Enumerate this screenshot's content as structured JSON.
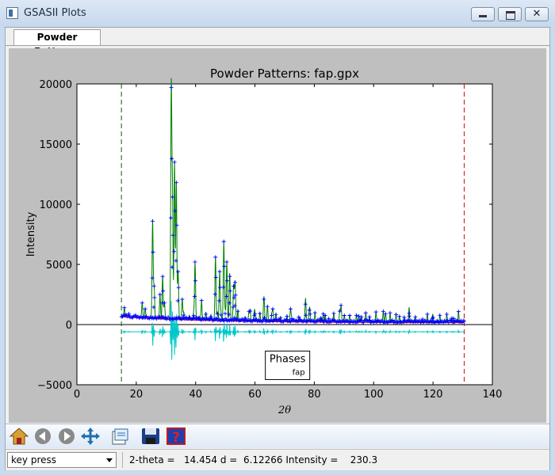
{
  "window": {
    "title": "GSASII Plots",
    "close_glyph": "✕"
  },
  "tabs": [
    {
      "label": "Powder Patterns"
    }
  ],
  "toolbar": {
    "icons": [
      "home-icon",
      "back-icon",
      "forward-icon",
      "pan-icon",
      "zoom-icon",
      "save-icon",
      "help-icon"
    ]
  },
  "status": {
    "mode_select": "key press",
    "readout": "2-theta =   14.454 d =  6.12266 Intensity =    230.3"
  },
  "colors": {
    "observed": "#0000ff",
    "calculated": "#008000",
    "difference": "#00c8c8",
    "background": "#ff0000",
    "limit_low": "#006400",
    "limit_high": "#e00000",
    "plot_bg": "#bfbfbf"
  },
  "chart_data": {
    "type": "scatter",
    "title": "Powder Patterns: fap.gpx",
    "xlabel": "2θ",
    "ylabel": "Intensity",
    "xlim": [
      0,
      140
    ],
    "ylim": [
      -5000,
      20000
    ],
    "xticks": [
      "0",
      "20",
      "40",
      "60",
      "80",
      "100",
      "120",
      "140"
    ],
    "yticks": [
      "−5000",
      "0",
      "5000",
      "10000",
      "15000",
      "20000"
    ],
    "limits": {
      "low": 15,
      "high": 130.5
    },
    "legend": {
      "title": "Phases",
      "entries": [
        {
          "name": "fap"
        }
      ],
      "placement": "bottom-center"
    },
    "peaks": [
      {
        "x": 16.0,
        "y": 1400
      },
      {
        "x": 17.5,
        "y": 900
      },
      {
        "x": 22.0,
        "y": 1800
      },
      {
        "x": 23.0,
        "y": 1300
      },
      {
        "x": 25.5,
        "y": 8600
      },
      {
        "x": 26.0,
        "y": 3200
      },
      {
        "x": 28.0,
        "y": 2500
      },
      {
        "x": 28.9,
        "y": 4000
      },
      {
        "x": 29.5,
        "y": 1800
      },
      {
        "x": 31.8,
        "y": 19700
      },
      {
        "x": 32.2,
        "y": 10600
      },
      {
        "x": 32.9,
        "y": 13500
      },
      {
        "x": 33.5,
        "y": 11800
      },
      {
        "x": 34.1,
        "y": 4400
      },
      {
        "x": 35.5,
        "y": 2100
      },
      {
        "x": 39.8,
        "y": 5200
      },
      {
        "x": 42.0,
        "y": 2000
      },
      {
        "x": 46.7,
        "y": 5600
      },
      {
        "x": 48.1,
        "y": 4400
      },
      {
        "x": 49.5,
        "y": 6900
      },
      {
        "x": 50.5,
        "y": 5200
      },
      {
        "x": 51.5,
        "y": 4000
      },
      {
        "x": 52.8,
        "y": 3200
      },
      {
        "x": 53.3,
        "y": 3500
      },
      {
        "x": 58.0,
        "y": 1100
      },
      {
        "x": 60.0,
        "y": 900
      },
      {
        "x": 63.0,
        "y": 2100
      },
      {
        "x": 64.2,
        "y": 1500
      },
      {
        "x": 66.0,
        "y": 1300
      },
      {
        "x": 72.0,
        "y": 1300
      },
      {
        "x": 77.0,
        "y": 1700
      },
      {
        "x": 78.3,
        "y": 1200
      },
      {
        "x": 83.0,
        "y": 900
      },
      {
        "x": 89.0,
        "y": 1600
      },
      {
        "x": 95.0,
        "y": 700
      },
      {
        "x": 104.0,
        "y": 900
      },
      {
        "x": 112.0,
        "y": 700
      },
      {
        "x": 120.0,
        "y": 600
      },
      {
        "x": 127.0,
        "y": 500
      }
    ]
  }
}
